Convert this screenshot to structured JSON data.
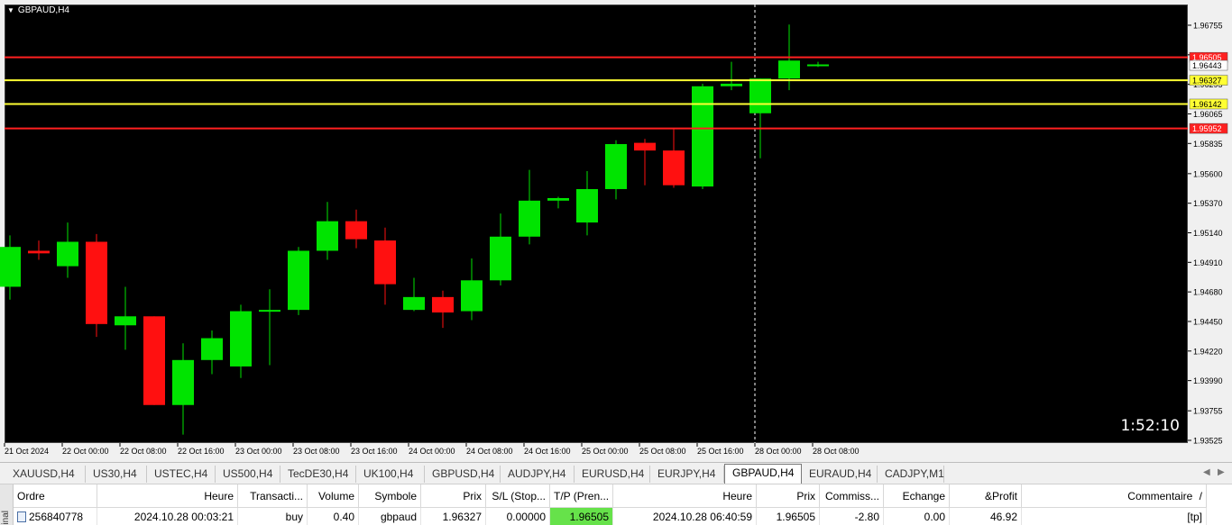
{
  "chart": {
    "symbol": "GBPAUD,H4",
    "timer": "1:52:10",
    "price_scale": [
      "1.96755",
      "1.96525",
      "1.96295",
      "1.96065",
      "1.95835",
      "1.95600",
      "1.95370",
      "1.95140",
      "1.94910",
      "1.94680",
      "1.94450",
      "1.94220",
      "1.93990",
      "1.93755",
      "1.93525"
    ],
    "time_scale": [
      "21 Oct 2024",
      "22 Oct 00:00",
      "22 Oct 08:00",
      "22 Oct 16:00",
      "23 Oct 00:00",
      "23 Oct 08:00",
      "23 Oct 16:00",
      "24 Oct 00:00",
      "24 Oct 08:00",
      "24 Oct 16:00",
      "25 Oct 00:00",
      "25 Oct 08:00",
      "25 Oct 16:00",
      "28 Oct 00:00",
      "28 Oct 08:00"
    ],
    "levels": [
      {
        "label": "1.96505",
        "price": 1.96505,
        "line_color": "#ff2020",
        "tag_bg": "#ff2020",
        "tag_fg": "#ffffff"
      },
      {
        "label": "1.96443",
        "price": 1.96443,
        "line_color": null,
        "tag_bg": "#ffffff",
        "tag_fg": "#000000"
      },
      {
        "label": "1.96327",
        "price": 1.96327,
        "line_color": "#ffff33",
        "tag_bg": "#ffff33",
        "tag_fg": "#000000"
      },
      {
        "label": "1.96142",
        "price": 1.96142,
        "line_color": "#ffff33",
        "tag_bg": "#ffff33",
        "tag_fg": "#000000"
      },
      {
        "label": "1.95952",
        "price": 1.95952,
        "line_color": "#ff2020",
        "tag_bg": "#ff2020",
        "tag_fg": "#ffffff"
      }
    ],
    "colors": {
      "bull": "#00e400",
      "bear": "#ff1010",
      "background": "#000000",
      "text": "#ffffff",
      "cursor": "#ffffff"
    },
    "candles": [
      {
        "o": 1.9472,
        "h": 1.9512,
        "l": 1.9462,
        "c": 1.9503
      },
      {
        "o": 1.95,
        "h": 1.9508,
        "l": 1.9493,
        "c": 1.9498
      },
      {
        "o": 1.9488,
        "h": 1.9522,
        "l": 1.9479,
        "c": 1.9507
      },
      {
        "o": 1.9507,
        "h": 1.9513,
        "l": 1.9433,
        "c": 1.9443
      },
      {
        "o": 1.9442,
        "h": 1.9472,
        "l": 1.9423,
        "c": 1.9449
      },
      {
        "o": 1.9449,
        "h": 1.9449,
        "l": 1.938,
        "c": 1.938
      },
      {
        "o": 1.938,
        "h": 1.9428,
        "l": 1.9357,
        "c": 1.9415
      },
      {
        "o": 1.9415,
        "h": 1.9438,
        "l": 1.9404,
        "c": 1.9432
      },
      {
        "o": 1.941,
        "h": 1.9458,
        "l": 1.9401,
        "c": 1.9453
      },
      {
        "o": 1.9453,
        "h": 1.947,
        "l": 1.9411,
        "c": 1.9454
      },
      {
        "o": 1.9454,
        "h": 1.9503,
        "l": 1.945,
        "c": 1.95
      },
      {
        "o": 1.95,
        "h": 1.9538,
        "l": 1.9493,
        "c": 1.9523
      },
      {
        "o": 1.9523,
        "h": 1.9532,
        "l": 1.9502,
        "c": 1.9509
      },
      {
        "o": 1.9508,
        "h": 1.9518,
        "l": 1.9458,
        "c": 1.9474
      },
      {
        "o": 1.9454,
        "h": 1.9479,
        "l": 1.9453,
        "c": 1.9464
      },
      {
        "o": 1.9464,
        "h": 1.9469,
        "l": 1.944,
        "c": 1.9452
      },
      {
        "o": 1.9453,
        "h": 1.9494,
        "l": 1.9446,
        "c": 1.9477
      },
      {
        "o": 1.9477,
        "h": 1.9529,
        "l": 1.9473,
        "c": 1.9511
      },
      {
        "o": 1.9511,
        "h": 1.9563,
        "l": 1.9505,
        "c": 1.9539
      },
      {
        "o": 1.9539,
        "h": 1.9542,
        "l": 1.9533,
        "c": 1.9541
      },
      {
        "o": 1.9522,
        "h": 1.9562,
        "l": 1.9512,
        "c": 1.9548
      },
      {
        "o": 1.9548,
        "h": 1.9586,
        "l": 1.954,
        "c": 1.9583
      },
      {
        "o": 1.9584,
        "h": 1.9587,
        "l": 1.9551,
        "c": 1.9578
      },
      {
        "o": 1.9578,
        "h": 1.9595,
        "l": 1.9549,
        "c": 1.9551
      },
      {
        "o": 1.955,
        "h": 1.963,
        "l": 1.9548,
        "c": 1.9628
      },
      {
        "o": 1.9628,
        "h": 1.9647,
        "l": 1.9625,
        "c": 1.963
      },
      {
        "o": 1.9607,
        "h": 1.9634,
        "l": 1.9572,
        "c": 1.9634
      },
      {
        "o": 1.9634,
        "h": 1.9676,
        "l": 1.9625,
        "c": 1.9648
      },
      {
        "o": 1.9645,
        "h": 1.9647,
        "l": 1.9643,
        "c": 1.9645
      }
    ]
  },
  "tabs": [
    {
      "label": "XAUUSD,H4",
      "active": false
    },
    {
      "label": "US30,H4",
      "active": false
    },
    {
      "label": "USTEC,H4",
      "active": false
    },
    {
      "label": "US500,H4",
      "active": false
    },
    {
      "label": "TecDE30,H4",
      "active": false
    },
    {
      "label": "UK100,H4",
      "active": false
    },
    {
      "label": "GBPUSD,H4",
      "active": false
    },
    {
      "label": "AUDJPY,H4",
      "active": false
    },
    {
      "label": "EURUSD,H4",
      "active": false
    },
    {
      "label": "EURJPY,H4",
      "active": false
    },
    {
      "label": "GBPAUD,H4",
      "active": true
    },
    {
      "label": "EURAUD,H4",
      "active": false
    },
    {
      "label": "CADJPY,M1",
      "active": false
    }
  ],
  "terminal": {
    "side_label": "inal",
    "columns": [
      "Ordre",
      "Heure",
      "Transacti...",
      "Volume",
      "Symbole",
      "Prix",
      "S/L (Stop...",
      "T/P (Pren...",
      "Heure",
      "Prix",
      "Commiss...",
      "Echange",
      "&Profit",
      "Commentaire"
    ],
    "sort_mark": "/",
    "row": [
      "256840778",
      "2024.10.28 00:03:21",
      "buy",
      "0.40",
      "gbpaud",
      "1.96327",
      "0.00000",
      "1.96505",
      "2024.10.28 06:40:59",
      "1.96505",
      "-2.80",
      "0.00",
      "46.92",
      "[tp]"
    ]
  }
}
